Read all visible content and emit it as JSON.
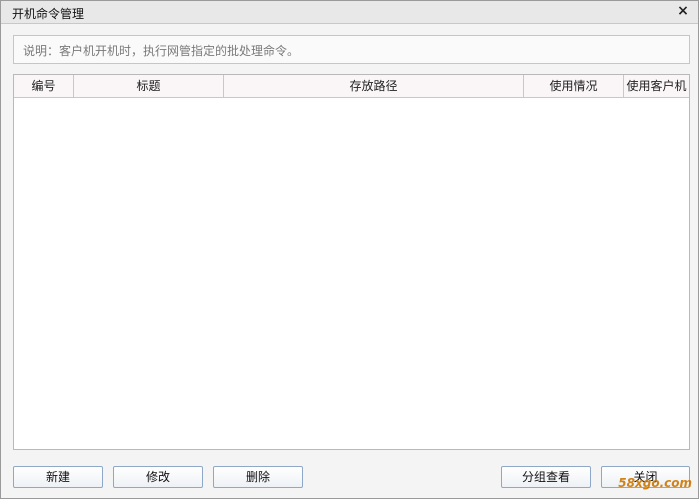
{
  "window": {
    "title": "开机命令管理",
    "close_glyph": "×"
  },
  "description": "说明：客户机开机时，执行网管指定的批处理命令。",
  "table": {
    "columns": [
      "编号",
      "标题",
      "存放路径",
      "使用情况",
      "使用客户机"
    ],
    "rows": []
  },
  "buttons": {
    "new": "新建",
    "edit": "修改",
    "delete": "删除",
    "group_view": "分组查看",
    "close": "关闭"
  },
  "watermark": "58xgo.com"
}
